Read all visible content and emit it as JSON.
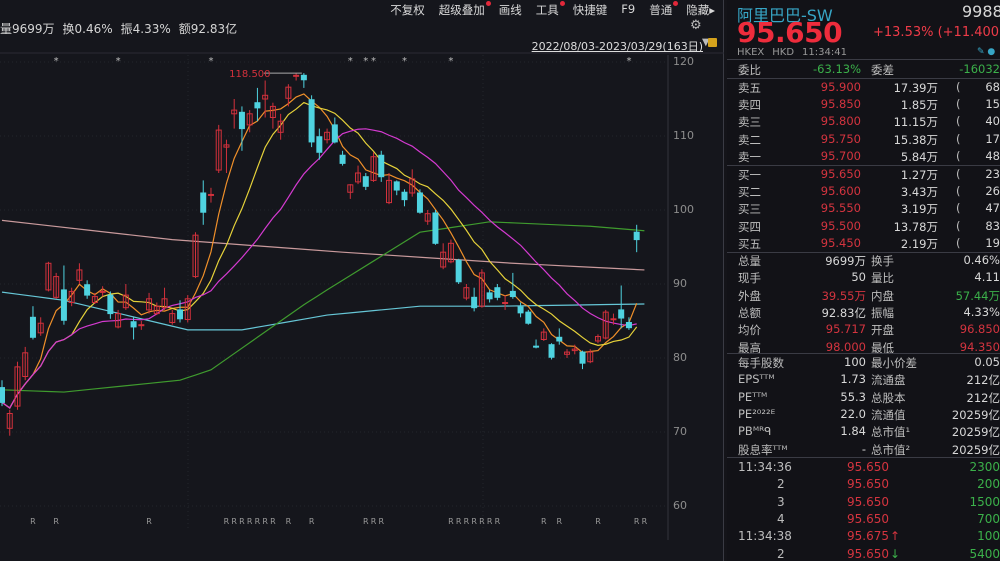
{
  "toolbar": {
    "items": [
      {
        "label": "不复权",
        "dot": false
      },
      {
        "label": "超级叠加",
        "dot": true
      },
      {
        "label": "画线",
        "dot": false
      },
      {
        "label": "工具",
        "dot": true
      },
      {
        "label": "快捷键",
        "dot": false
      },
      {
        "label": "F9",
        "dot": false
      },
      {
        "label": "普通",
        "dot": true
      },
      {
        "label": "隐藏▸",
        "dot": false
      }
    ]
  },
  "infoline": [
    "量9699万",
    "换0.46%",
    "振4.33%",
    "额92.83亿"
  ],
  "date_range": "2022/08/03-2023/03/29(163日)",
  "chart_data": {
    "type": "candlestick",
    "ylim": [
      57,
      121
    ],
    "yticks": [
      120,
      110,
      100,
      90,
      80,
      70,
      60
    ],
    "high_label": "118.500",
    "high_index": 39,
    "candles": [
      [
        76,
        77,
        73.5,
        74
      ],
      [
        70.5,
        73,
        69.5,
        72.5
      ],
      [
        73.5,
        79.5,
        73,
        78.8
      ],
      [
        77.5,
        81.5,
        77,
        80.7
      ],
      [
        85.5,
        87,
        82.5,
        82.8
      ],
      [
        83.4,
        85.5,
        83,
        84.7
      ],
      [
        89.2,
        93,
        89,
        92.8
      ],
      [
        88.2,
        91.5,
        88,
        91
      ],
      [
        89.2,
        92.5,
        84.5,
        85.1
      ],
      [
        87.5,
        89.5,
        87,
        89
      ],
      [
        90.5,
        92.8,
        90,
        91.9
      ],
      [
        89.9,
        90.5,
        88,
        88.5
      ],
      [
        87.5,
        88.8,
        87.3,
        88.3
      ],
      [
        89,
        89.7,
        88.3,
        89
      ],
      [
        88.5,
        89,
        85.3,
        86
      ],
      [
        84.2,
        86.5,
        84,
        86
      ],
      [
        86.8,
        90,
        86.5,
        88.5
      ],
      [
        84.9,
        85.5,
        82.5,
        84.2
      ],
      [
        84.5,
        85,
        83.8,
        84.5
      ],
      [
        86.5,
        88.8,
        86,
        88
      ],
      [
        86,
        87.5,
        85.8,
        87
      ],
      [
        86.8,
        89.5,
        86.5,
        88
      ],
      [
        84.8,
        86.5,
        84.5,
        86
      ],
      [
        86.5,
        87.8,
        84.8,
        85.3
      ],
      [
        85.2,
        88.5,
        84.8,
        88
      ],
      [
        91,
        97,
        90.8,
        96.6
      ],
      [
        102.3,
        104,
        98,
        99.7
      ],
      [
        102,
        103,
        101,
        102.1
      ],
      [
        105.4,
        111.5,
        105,
        110.8
      ],
      [
        108.5,
        109.5,
        105,
        108.8
      ],
      [
        113,
        115,
        111,
        113.5
      ],
      [
        113.2,
        114,
        108,
        111
      ],
      [
        111.5,
        113.5,
        110.5,
        113
      ],
      [
        114.5,
        116.5,
        112,
        113.8
      ],
      [
        115,
        117.5,
        112.5,
        115.5
      ],
      [
        112.5,
        114.5,
        111,
        114
      ],
      [
        110.5,
        113,
        109.5,
        112
      ],
      [
        115.1,
        117,
        114,
        116.6
      ],
      [
        118.2,
        118.5,
        117.5,
        118.2
      ],
      [
        118.2,
        118.5,
        116.5,
        117.6
      ],
      [
        114.9,
        115.5,
        108.5,
        109.2
      ],
      [
        109.9,
        111,
        106.8,
        107.8
      ],
      [
        109.5,
        111,
        109,
        110.5
      ],
      [
        111.5,
        112.5,
        109,
        109.2
      ],
      [
        107.4,
        108,
        106,
        106.3
      ],
      [
        102.4,
        103.5,
        101.5,
        103.4
      ],
      [
        103.8,
        106,
        103.5,
        105
      ],
      [
        104.5,
        105,
        102.7,
        103.2
      ],
      [
        104,
        107.8,
        103.8,
        107.2
      ],
      [
        107.4,
        108,
        103.8,
        104.5
      ],
      [
        101,
        105,
        100.8,
        104
      ],
      [
        103.8,
        104,
        102,
        102.7
      ],
      [
        102.4,
        102.8,
        100.5,
        101.4
      ],
      [
        102.3,
        105.5,
        101.8,
        104.2
      ],
      [
        102.3,
        102.8,
        99.5,
        99.7
      ],
      [
        98.5,
        100,
        98,
        99.5
      ],
      [
        99.6,
        100,
        95.3,
        95.5
      ],
      [
        92.3,
        95.5,
        92,
        94.3
      ],
      [
        93,
        96,
        92.8,
        95.5
      ],
      [
        93.2,
        93.4,
        90,
        90.3
      ],
      [
        88.1,
        90,
        87.8,
        89.5
      ],
      [
        88.2,
        89.5,
        86.3,
        86.8
      ],
      [
        87,
        92,
        86.8,
        91.5
      ],
      [
        88.8,
        89.2,
        87.5,
        88
      ],
      [
        89.5,
        90,
        87.8,
        88.2
      ],
      [
        87.5,
        88.5,
        86.5,
        87.5
      ],
      [
        89,
        91.5,
        88,
        88.3
      ],
      [
        86.9,
        87.5,
        85.5,
        86.1
      ],
      [
        86.2,
        86.5,
        84.5,
        84.7
      ],
      [
        81.6,
        82.5,
        81.3,
        81.5
      ],
      [
        82.5,
        84,
        82.3,
        83.5
      ],
      [
        81.8,
        82,
        79.8,
        80.1
      ],
      [
        82.8,
        84,
        81.8,
        82.3
      ],
      [
        80.5,
        81.2,
        80,
        80.8
      ],
      [
        81,
        81.8,
        80.5,
        81.2
      ],
      [
        80.8,
        81,
        78.5,
        79.3
      ],
      [
        79.5,
        81.2,
        79.3,
        80.8
      ],
      [
        82.3,
        83.2,
        82,
        82.9
      ],
      [
        82.7,
        86.5,
        82.5,
        86.2
      ],
      [
        85.2,
        86,
        84.5,
        85.3
      ],
      [
        86.5,
        89.8,
        84,
        85.4
      ],
      [
        84.8,
        85.5,
        83.8,
        84.1
      ],
      [
        97,
        98,
        94.3,
        96
      ]
    ],
    "long_ma": [
      {
        "name": "ma-pink",
        "color": "#c99a9c",
        "points": [
          [
            0,
            98.6
          ],
          [
            22,
            96
          ],
          [
            44,
            94.3
          ],
          [
            66,
            92.8
          ],
          [
            83,
            91.9
          ]
        ]
      },
      {
        "name": "ma-lightblue",
        "color": "#66c6d6",
        "points": [
          [
            0,
            88.9
          ],
          [
            8,
            87.8
          ],
          [
            24,
            83.8
          ],
          [
            31,
            83.8
          ],
          [
            42,
            85.8
          ],
          [
            54,
            87
          ],
          [
            64,
            87
          ],
          [
            83,
            87.3
          ]
        ]
      },
      {
        "name": "ma-green",
        "color": "#3f9b2e",
        "points": [
          [
            0,
            75.7
          ],
          [
            8,
            75.4
          ],
          [
            23,
            77
          ],
          [
            27,
            78.4
          ],
          [
            39,
            87.2
          ],
          [
            42,
            89.2
          ],
          [
            54,
            97
          ],
          [
            63,
            98.4
          ],
          [
            76,
            97.8
          ],
          [
            83,
            97.2
          ]
        ]
      }
    ],
    "short_ma": [
      {
        "name": "ma5",
        "period": 5,
        "color": "#f0902a"
      },
      {
        "name": "ma10",
        "period": 10,
        "color": "#e6d23a"
      },
      {
        "name": "ma20",
        "period": 20,
        "color": "#d43ad0"
      }
    ],
    "star_indices": [
      7,
      15,
      27,
      45,
      47,
      48,
      52,
      58,
      81
    ],
    "r_indices": [
      4,
      7,
      19,
      29,
      30,
      31,
      32,
      33,
      34,
      35,
      37,
      40,
      47,
      48,
      49,
      58,
      59,
      60,
      61,
      62,
      63,
      64,
      70,
      72,
      77,
      82,
      83
    ],
    "up_color": "#d3313c",
    "down_color": "#4fd3e0"
  },
  "quote": {
    "name": "阿里巴巴-SW",
    "code": "9988",
    "price": "95.650",
    "change": "+13.53% (+11.400",
    "exchange": "HKEX",
    "currency": "HKD",
    "time": "11:34:41"
  },
  "weibi": {
    "label": "委比",
    "value": "-63.13%",
    "label2": "委差",
    "value2": "-16032"
  },
  "asks": [
    {
      "label": "卖五",
      "price": "95.900",
      "vol": "17.39万",
      "count": "68"
    },
    {
      "label": "卖四",
      "price": "95.850",
      "vol": "1.85万",
      "count": "15"
    },
    {
      "label": "卖三",
      "price": "95.800",
      "vol": "11.15万",
      "count": "40"
    },
    {
      "label": "卖二",
      "price": "95.750",
      "vol": "15.38万",
      "count": "17"
    },
    {
      "label": "卖一",
      "price": "95.700",
      "vol": "5.84万",
      "count": "48"
    }
  ],
  "bids": [
    {
      "label": "买一",
      "price": "95.650",
      "vol": "1.27万",
      "count": "23"
    },
    {
      "label": "买二",
      "price": "95.600",
      "vol": "3.43万",
      "count": "26"
    },
    {
      "label": "买三",
      "price": "95.550",
      "vol": "3.19万",
      "count": "47"
    },
    {
      "label": "买四",
      "price": "95.500",
      "vol": "13.78万",
      "count": "83"
    },
    {
      "label": "买五",
      "price": "95.450",
      "vol": "2.19万",
      "count": "19"
    }
  ],
  "stats": [
    {
      "l1": "总量",
      "v1": "9699万",
      "c1": "white",
      "l2": "换手",
      "v2": "0.46%",
      "c2": "white"
    },
    {
      "l1": "现手",
      "v1": "50",
      "c1": "white",
      "l2": "量比",
      "v2": "4.11",
      "c2": "white"
    },
    {
      "l1": "外盘",
      "v1": "39.55万",
      "c1": "red",
      "l2": "内盘",
      "v2": "57.44万",
      "c2": "green"
    },
    {
      "l1": "总额",
      "v1": "92.83亿",
      "c1": "white",
      "l2": "振幅",
      "v2": "4.33%",
      "c2": "white"
    },
    {
      "l1": "均价",
      "v1": "95.717",
      "c1": "red",
      "l2": "开盘",
      "v2": "96.850",
      "c2": "red"
    },
    {
      "l1": "最高",
      "v1": "98.000",
      "c1": "red",
      "l2": "最低",
      "v2": "94.350",
      "c2": "red"
    }
  ],
  "fundamentals": [
    {
      "l1": "每手股数",
      "v1": "100",
      "l2": "最小价差",
      "v2": "0.05"
    },
    {
      "l1": "EPSᵀᵀᴹ",
      "v1": "1.73",
      "l2": "流通盘",
      "v2": "212亿"
    },
    {
      "l1": "PEᵀᵀᴹ",
      "v1": "55.3",
      "l2": "总股本",
      "v2": "212亿"
    },
    {
      "l1": "PE²⁰²²ᴱ",
      "v1": "22.0",
      "l2": "流通值",
      "v2": "20259亿"
    },
    {
      "l1": "PBᴹᴿᑫ",
      "v1": "1.84",
      "l2": "总市值¹",
      "v2": "20259亿"
    },
    {
      "l1": "股息率ᵀᵀᴹ",
      "v1": "-",
      "l2": "总市值²",
      "v2": "20259亿"
    }
  ],
  "ticks": [
    {
      "time": "11:34:36",
      "price": "95.650",
      "vol": "2300",
      "arrow": ""
    },
    {
      "time": "2",
      "price": "95.650",
      "vol": "200",
      "arrow": ""
    },
    {
      "time": "3",
      "price": "95.650",
      "vol": "1500",
      "arrow": ""
    },
    {
      "time": "4",
      "price": "95.650",
      "vol": "700",
      "arrow": ""
    },
    {
      "time": "11:34:38",
      "price": "95.675",
      "vol": "100",
      "arrow": "up"
    },
    {
      "time": "2",
      "price": "95.650",
      "vol": "5400",
      "arrow": "down"
    }
  ]
}
